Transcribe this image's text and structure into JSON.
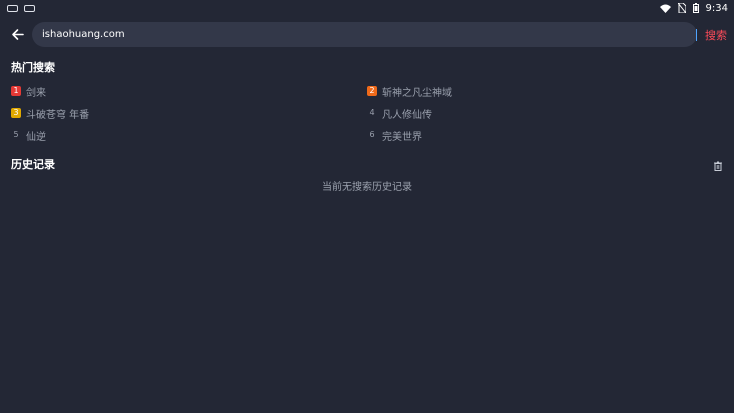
{
  "status_bar": {
    "time": "9:34",
    "icons": [
      "notification-icon",
      "cast-icon",
      "wifi-icon",
      "no-sim-icon",
      "battery-icon"
    ]
  },
  "search": {
    "value": "ishaohuang.com",
    "button_label": "搜索",
    "accent_color": "#ff4b59"
  },
  "hot": {
    "title": "热门搜索",
    "items": [
      {
        "rank": "1",
        "label": "剑来",
        "color": "#e53935"
      },
      {
        "rank": "2",
        "label": "斩神之凡尘神域",
        "color": "#f06a1a"
      },
      {
        "rank": "3",
        "label": "斗破苍穹 年番",
        "color": "#e0a800"
      },
      {
        "rank": "4",
        "label": "凡人修仙传",
        "color": ""
      },
      {
        "rank": "5",
        "label": "仙逆",
        "color": ""
      },
      {
        "rank": "6",
        "label": "完美世界",
        "color": ""
      }
    ]
  },
  "history": {
    "title": "历史记录",
    "empty_text": "当前无搜索历史记录"
  }
}
